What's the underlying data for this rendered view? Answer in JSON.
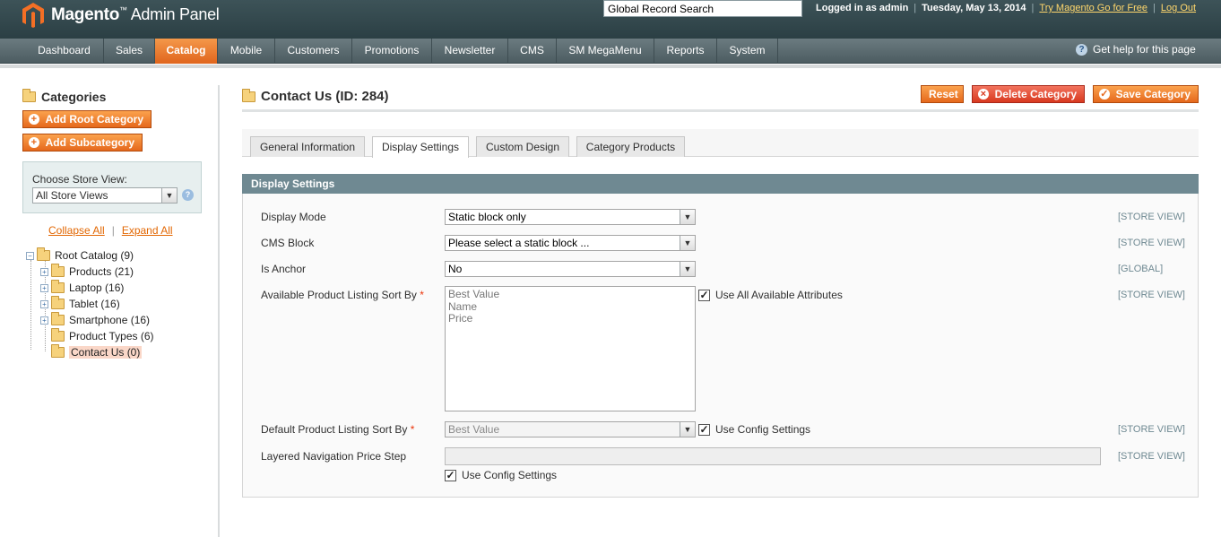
{
  "header": {
    "logo_text": "Magento",
    "logo_tm": "™",
    "logo_sub": "Admin Panel",
    "global_search_value": "Global Record Search",
    "logged_in": "Logged in as admin",
    "date": "Tuesday, May 13, 2014",
    "try_link": "Try Magento Go for Free",
    "logout_link": "Log Out",
    "sep": "|"
  },
  "nav": {
    "items": [
      "Dashboard",
      "Sales",
      "Catalog",
      "Mobile",
      "Customers",
      "Promotions",
      "Newsletter",
      "CMS",
      "SM MegaMenu",
      "Reports",
      "System"
    ],
    "active": "Catalog",
    "help": "Get help for this page",
    "help_icon_glyph": "?"
  },
  "sidebar": {
    "title": "Categories",
    "add_root_button": "Add Root Category",
    "add_sub_button": "Add Subcategory",
    "store_view_label": "Choose Store View:",
    "store_view_value": "All Store Views",
    "collapse_all": "Collapse All",
    "expand_all": "Expand All",
    "link_sep": "|",
    "tree": [
      "Root Catalog (9)",
      "Products (21)",
      "Laptop (16)",
      "Tablet (16)",
      "Smartphone (16)",
      "Product Types (6)",
      "Contact Us (0)"
    ]
  },
  "main": {
    "title": "Contact Us (ID: 284)",
    "reset_button": "Reset",
    "delete_button": "Delete Category",
    "save_button": "Save Category",
    "tabs": [
      "General Information",
      "Display Settings",
      "Custom Design",
      "Category Products"
    ],
    "active_tab": "Display Settings",
    "section_title": "Display Settings",
    "fields": {
      "display_mode": {
        "label": "Display Mode",
        "value": "Static block only",
        "scope": "[STORE VIEW]"
      },
      "cms_block": {
        "label": "CMS Block",
        "value": "Please select a static block ...",
        "scope": "[STORE VIEW]"
      },
      "is_anchor": {
        "label": "Is Anchor",
        "value": "No",
        "scope": "[GLOBAL]"
      },
      "sort_by": {
        "label": "Available Product Listing Sort By",
        "required": "*",
        "options": [
          "Best Value",
          "Name",
          "Price"
        ],
        "checkbox": "Use All Available Attributes",
        "scope": "[STORE VIEW]"
      },
      "default_sort": {
        "label": "Default Product Listing Sort By",
        "required": "*",
        "value": "Best Value",
        "checkbox": "Use Config Settings",
        "scope": "[STORE VIEW]"
      },
      "price_step": {
        "label": "Layered Navigation Price Step",
        "value": "",
        "checkbox": "Use Config Settings",
        "scope": "[STORE VIEW]"
      }
    }
  },
  "colors": {
    "accent": "#e5681c",
    "header": "#2b3f44",
    "section": "#6f8992"
  }
}
